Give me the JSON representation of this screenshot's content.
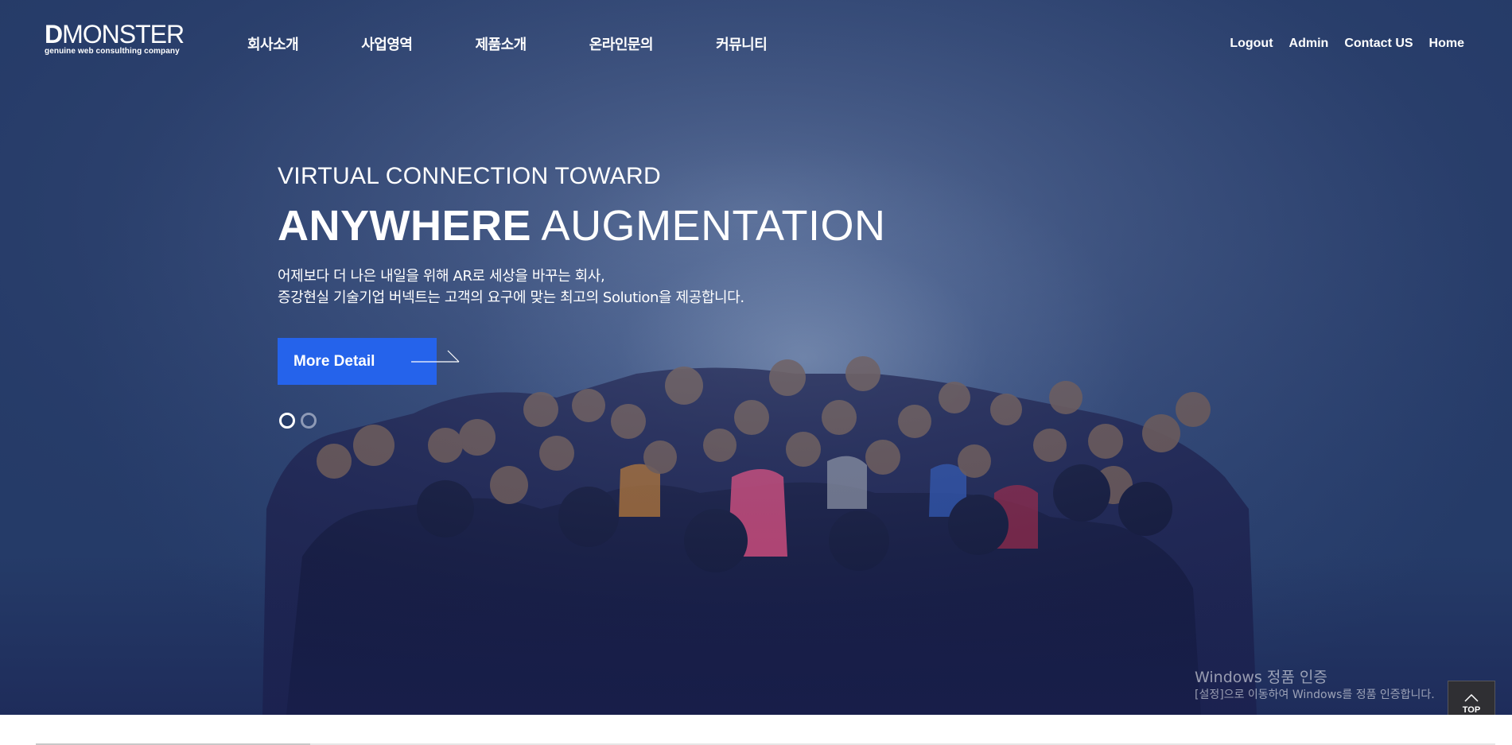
{
  "header": {
    "logo_text_d": "D",
    "logo_text_rest": "MONSTER",
    "logo_sub": "genuine web consulthing company",
    "nav": [
      "회사소개",
      "사업영역",
      "제품소개",
      "온라인문의",
      "커뮤니티"
    ],
    "util": [
      "Logout",
      "Admin",
      "Contact US",
      "Home"
    ]
  },
  "hero": {
    "eyebrow": "VIRTUAL CONNECTION TOWARD",
    "headline_bold": "ANYWHERE",
    "headline_light": "AUGMENTATION",
    "desc_line1": "어제보다 더 나은 내일을 위해 AR로 세상을 바꾸는 회사,",
    "desc_line2": "증강현실 기술기업 버넥트는 고객의 요구에 맞는 최고의 Solution을 제공합니다.",
    "button_label": "More Detail",
    "slides_total": 2,
    "slide_active": 1,
    "background_image": "crowd of people looking up under spotlight"
  },
  "watermark": {
    "line1": "Windows 정품 인증",
    "line2": "[설정]으로 이동하여 Windows를 정품 인증합니다."
  },
  "top_button": {
    "label": "TOP",
    "icon": "chevron-up-icon"
  },
  "colors": {
    "hero_bg": "#2e4574",
    "button_bg": "#2563eb",
    "text": "#ffffff"
  }
}
